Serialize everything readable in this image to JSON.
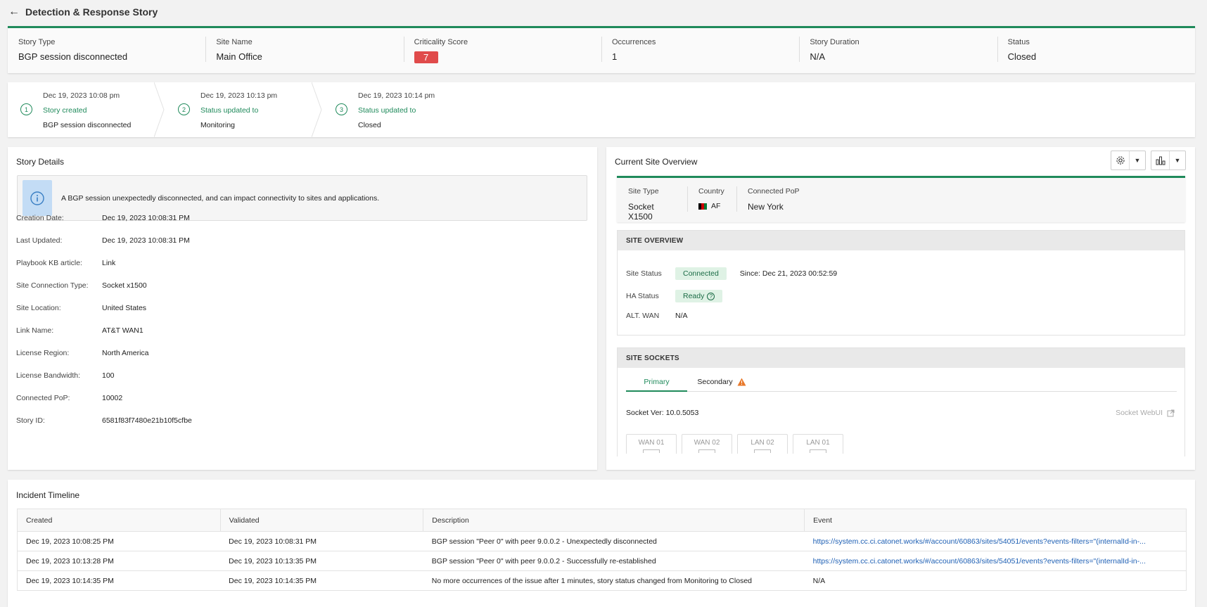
{
  "header": {
    "title": "Detection & Response Story"
  },
  "summary": {
    "story_type_label": "Story Type",
    "story_type": "BGP session disconnected",
    "site_name_label": "Site Name",
    "site_name": "Main Office",
    "criticality_label": "Criticality Score",
    "criticality": "7",
    "occurrences_label": "Occurrences",
    "occurrences": "1",
    "duration_label": "Story Duration",
    "duration": "N/A",
    "status_label": "Status",
    "status": "Closed"
  },
  "timeline": [
    {
      "num": "1",
      "date": "Dec 19, 2023 10:08 pm",
      "action": "Story created",
      "sub": "BGP session disconnected"
    },
    {
      "num": "2",
      "date": "Dec 19, 2023 10:13 pm",
      "action": "Status updated to",
      "sub": "Monitoring"
    },
    {
      "num": "3",
      "date": "Dec 19, 2023 10:14 pm",
      "action": "Status updated to",
      "sub": "Closed"
    }
  ],
  "details": {
    "title": "Story Details",
    "info": "A BGP session unexpectedly disconnected, and can impact connectivity to sites and applications.",
    "rows": [
      {
        "k": "Creation Date:",
        "v": "Dec 19, 2023 10:08:31 PM"
      },
      {
        "k": "Last Updated:",
        "v": "Dec 19, 2023 10:08:31 PM"
      },
      {
        "k": "Playbook KB article:",
        "v": "Link"
      },
      {
        "k": "Site Connection Type:",
        "v": "Socket x1500"
      },
      {
        "k": "Site Location:",
        "v": "United States"
      },
      {
        "k": "Link Name:",
        "v": "AT&T WAN1"
      },
      {
        "k": "License Region:",
        "v": "North America"
      },
      {
        "k": "License Bandwidth:",
        "v": "100"
      },
      {
        "k": "Connected PoP:",
        "v": "10002"
      },
      {
        "k": "Story ID:",
        "v": "6581f83f7480e21b10f5cfbe"
      }
    ]
  },
  "overview": {
    "title": "Current Site Overview",
    "site_type_label": "Site Type",
    "site_type": "Socket X1500",
    "country_label": "Country",
    "country": "AF",
    "pop_label": "Connected PoP",
    "pop": "New York",
    "site_overview_head": "SITE OVERVIEW",
    "site_status_label": "Site Status",
    "site_status": "Connected",
    "since": "Since: Dec 21, 2023 00:52:59",
    "ha_status_label": "HA Status",
    "ha_status": "Ready",
    "alt_wan_label": "ALT. WAN",
    "alt_wan": "N/A",
    "sockets_head": "SITE SOCKETS",
    "tab_primary": "Primary",
    "tab_secondary": "Secondary",
    "socket_ver": "Socket Ver: 10.0.5053",
    "webui": "Socket WebUI",
    "ports": [
      "WAN 01",
      "WAN 02",
      "LAN 02",
      "LAN 01"
    ]
  },
  "incident": {
    "title": "Incident Timeline",
    "columns": [
      "Created",
      "Validated",
      "Description",
      "Event"
    ],
    "rows": [
      [
        "Dec 19, 2023 10:08:25 PM",
        "Dec 19, 2023 10:08:31 PM",
        "BGP session \"Peer 0\" with peer 9.0.0.2 - Unexpectedly disconnected",
        "https://system.cc.ci.catonet.works/#/account/60863/sites/54051/events?events-filters=\"(internalId-in-..."
      ],
      [
        "Dec 19, 2023 10:13:28 PM",
        "Dec 19, 2023 10:13:35 PM",
        "BGP session \"Peer 0\" with peer 9.0.0.2 - Successfully re-established",
        "https://system.cc.ci.catonet.works/#/account/60863/sites/54051/events?events-filters=\"(internalId-in-..."
      ],
      [
        "Dec 19, 2023 10:14:35 PM",
        "Dec 19, 2023 10:14:35 PM",
        "No more occurrences of the issue after 1 minutes, story status changed from Monitoring to Closed",
        "N/A"
      ]
    ]
  },
  "colors": {
    "accent": "#1f8a5b",
    "critical": "#e04b4b",
    "link": "#1d5fb4",
    "warning": "#e8792b"
  }
}
